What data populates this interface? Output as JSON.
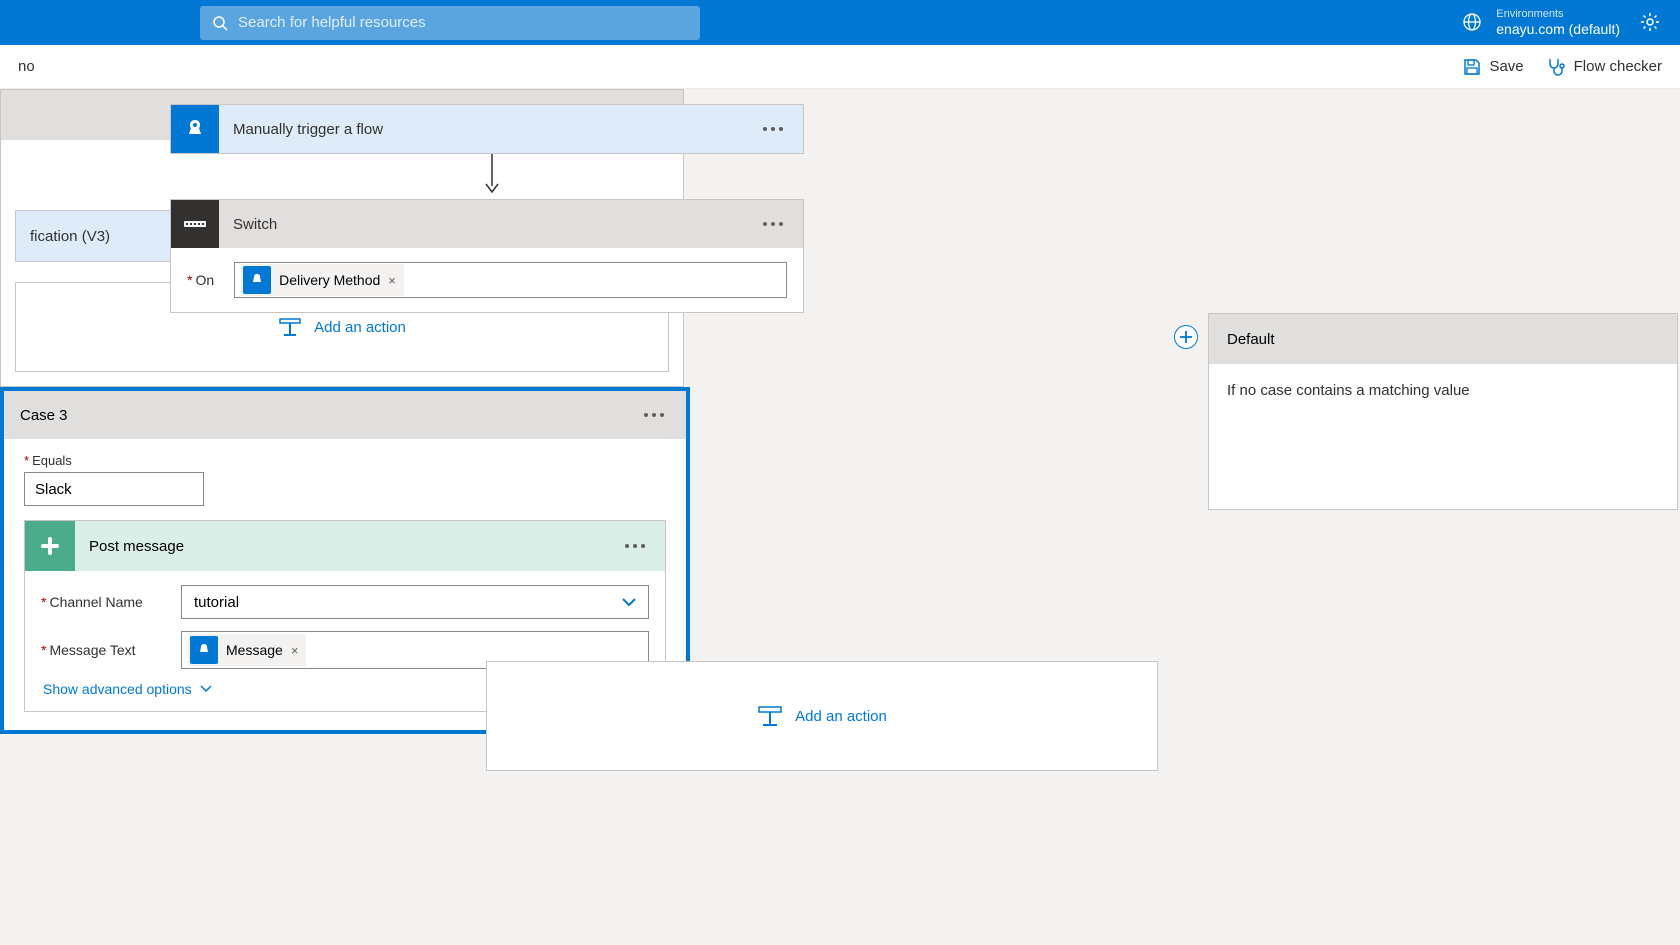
{
  "header": {
    "search_placeholder": "Search for helpful resources",
    "env_label": "Environments",
    "env_value": "enayu.com (default)"
  },
  "cmdbar": {
    "breadcrumb_tail": "no",
    "save": "Save",
    "flow_checker": "Flow checker"
  },
  "trigger": {
    "title": "Manually trigger a flow"
  },
  "switch": {
    "title": "Switch",
    "on_label": "On",
    "on_token": "Delivery Method"
  },
  "case_left": {
    "notif_title": "fication (V3)",
    "add_action": "Add an action"
  },
  "case3": {
    "title": "Case 3",
    "equals_label": "Equals",
    "equals_value": "Slack",
    "post": {
      "title": "Post message",
      "channel_label": "Channel Name",
      "channel_value": "tutorial",
      "msg_label": "Message Text",
      "msg_token": "Message",
      "adv": "Show advanced options"
    },
    "add_action": "Add an action"
  },
  "default": {
    "title": "Default",
    "body": "If no case contains a matching value"
  }
}
